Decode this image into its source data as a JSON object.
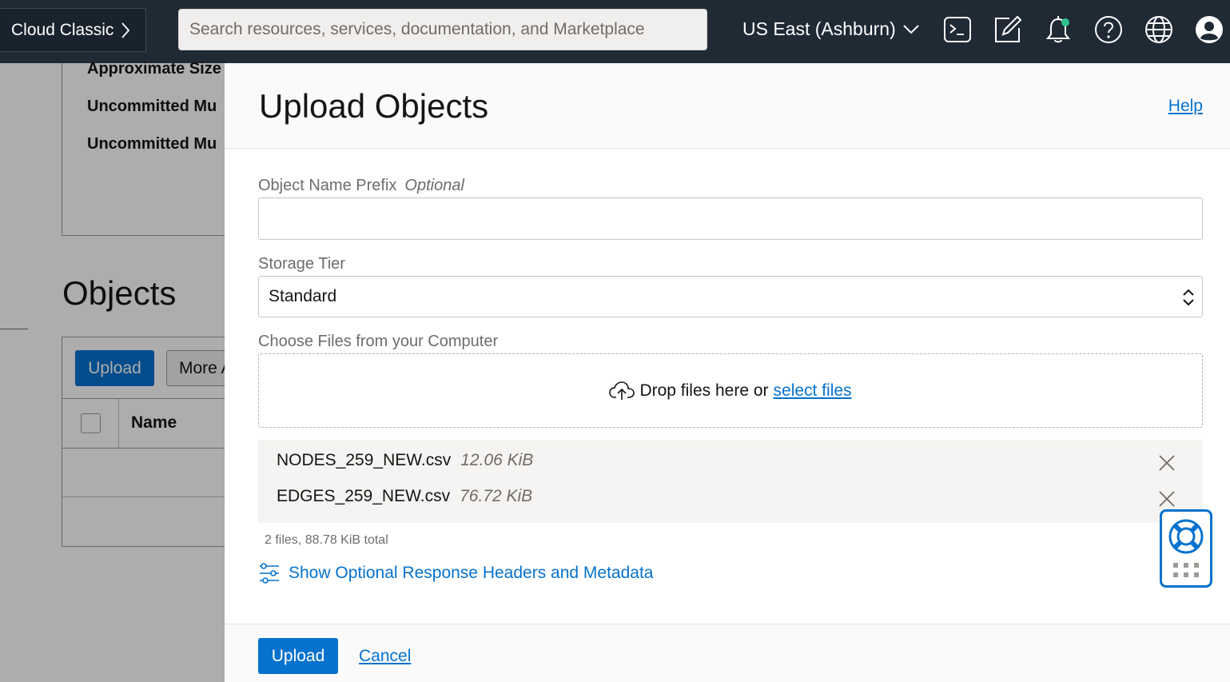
{
  "topbar": {
    "brand": "Cloud Classic",
    "search_placeholder": "Search resources, services, documentation, and Marketplace",
    "region": "US East (Ashburn)",
    "icons": [
      "cloud-shell-icon",
      "edit-icon",
      "notification-bell-icon",
      "help-icon",
      "language-globe-icon",
      "user-profile-icon"
    ],
    "notification_dot_color": "#2fc48d"
  },
  "background": {
    "details": [
      "Approximate Size",
      "Uncommitted Mu",
      "Uncommitted Mu"
    ],
    "objects_heading": "Objects",
    "upload_label": "Upload",
    "more_label": "More Actions",
    "name_header": "Name"
  },
  "drawer": {
    "title": "Upload Objects",
    "help_label": "Help",
    "prefix_label": "Object Name Prefix",
    "prefix_optional": "Optional",
    "prefix_value": "",
    "storage_tier_label": "Storage Tier",
    "storage_tier_value": "Standard",
    "choose_files_label": "Choose Files from your Computer",
    "drop_text": "Drop files here or",
    "select_files_link": "select files",
    "files": [
      {
        "name": "NODES_259_NEW.csv",
        "size": "12.06 KiB"
      },
      {
        "name": "EDGES_259_NEW.csv",
        "size": "76.72 KiB"
      }
    ],
    "files_total": "2 files, 88.78 KiB total",
    "optional_headers_link": "Show Optional Response Headers and Metadata",
    "upload_button": "Upload",
    "cancel_link": "Cancel"
  },
  "colors": {
    "topbar_bg": "#1f2a35",
    "accent_blue": "#0572ce"
  }
}
